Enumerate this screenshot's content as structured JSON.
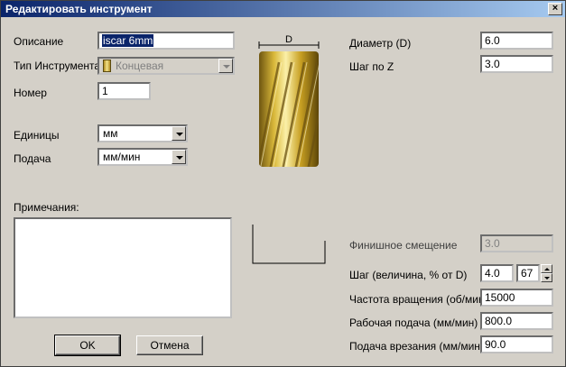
{
  "window": {
    "title": "Редактировать инструмент"
  },
  "left": {
    "description_label": "Описание",
    "description_value": "iscar 6mm",
    "tool_type_label": "Тип Инструмента",
    "tool_type_value": "Концевая",
    "number_label": "Номер",
    "number_value": "1",
    "units_label": "Единицы",
    "units_value": "мм",
    "feed_label": "Подача",
    "feed_value": "мм/мин",
    "notes_label": "Примечания:",
    "notes_value": ""
  },
  "diagram": {
    "d_label": "D"
  },
  "right": {
    "diameter_label": "Диаметр (D)",
    "diameter_value": "6.0",
    "stepz_label": "Шаг по Z",
    "stepz_value": "3.0",
    "finish_label": "Финишное смещение",
    "finish_value": "3.0",
    "step_label": "Шаг (величина, % от D)",
    "step_value": "4.0",
    "step_percent": "67",
    "spindle_label": "Частота вращения (об/мин)",
    "spindle_value": "15000",
    "workfeed_label": "Рабочая подача (мм/мин)",
    "workfeed_value": "800.0",
    "plunge_label": "Подача врезания (мм/мин)",
    "plunge_value": "90.0"
  },
  "buttons": {
    "ok": "OK",
    "cancel": "Отмена",
    "close": "×"
  }
}
